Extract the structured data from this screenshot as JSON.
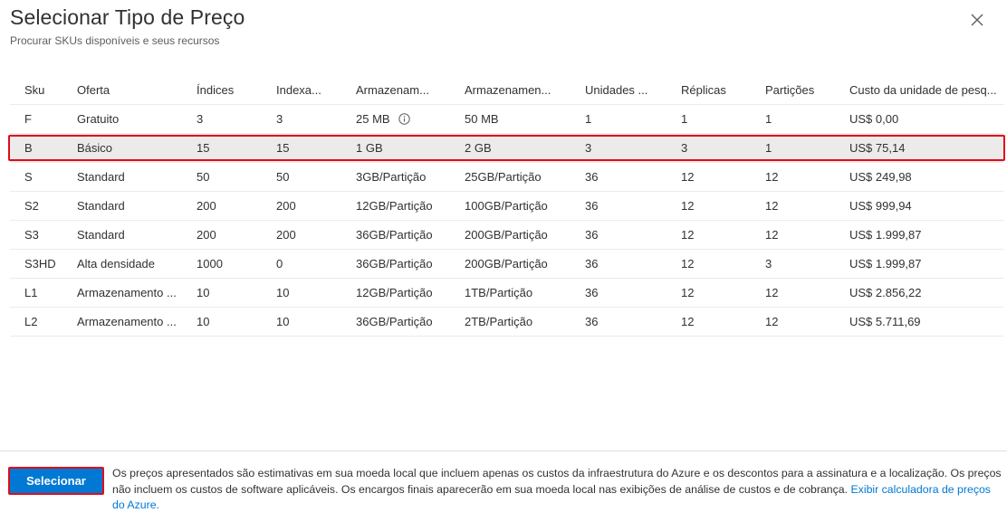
{
  "panel": {
    "title": "Selecionar Tipo de Preço",
    "subtitle": "Procurar SKUs disponíveis e seus recursos",
    "close_icon": "close-icon"
  },
  "table": {
    "columns": [
      "Sku",
      "Oferta",
      "Índices",
      "Indexa...",
      "Armazenam...",
      "Armazenamen...",
      "Unidades ...",
      "Réplicas",
      "Partições",
      "Custo da unidade de pesq..."
    ],
    "rows": [
      [
        "F",
        "Gratuito",
        "3",
        "3",
        "25 MB",
        "50 MB",
        "1",
        "1",
        "1",
        "US$ 0,00"
      ],
      [
        "B",
        "Básico",
        "15",
        "15",
        "1 GB",
        "2 GB",
        "3",
        "3",
        "1",
        "US$ 75,14"
      ],
      [
        "S",
        "Standard",
        "50",
        "50",
        "3GB/Partição",
        "25GB/Partição",
        "36",
        "12",
        "12",
        "US$ 249,98"
      ],
      [
        "S2",
        "Standard",
        "200",
        "200",
        "12GB/Partição",
        "100GB/Partição",
        "36",
        "12",
        "12",
        "US$ 999,94"
      ],
      [
        "S3",
        "Standard",
        "200",
        "200",
        "36GB/Partição",
        "200GB/Partição",
        "36",
        "12",
        "12",
        "US$ 1.999,87"
      ],
      [
        "S3HD",
        "Alta densidade",
        "1000",
        "0",
        "36GB/Partição",
        "200GB/Partição",
        "36",
        "12",
        "3",
        "US$ 1.999,87"
      ],
      [
        "L1",
        "Armazenamento ...",
        "10",
        "10",
        "12GB/Partição",
        "1TB/Partição",
        "36",
        "12",
        "12",
        "US$ 2.856,22"
      ],
      [
        "L2",
        "Armazenamento ...",
        "10",
        "10",
        "36GB/Partição",
        "2TB/Partição",
        "36",
        "12",
        "12",
        "US$ 5.711,69"
      ]
    ],
    "selected_sku": "B",
    "info_icon": "info-icon"
  },
  "footer": {
    "select_label": "Selecionar",
    "disclaimer": "Os preços apresentados são estimativas em sua moeda local que incluem apenas os custos da infraestrutura do Azure e os descontos para a assinatura e a localização. Os preços não incluem os custos de software aplicáveis. Os encargos finais aparecerão em sua moeda local nas exibições de análise de custos e de cobrança.",
    "link_text": "Exibir calculadora de preços do Azure."
  },
  "colors": {
    "accent": "#0078d4",
    "highlight_outline": "#e00b1c",
    "selected_row_bg": "#edebe9"
  }
}
